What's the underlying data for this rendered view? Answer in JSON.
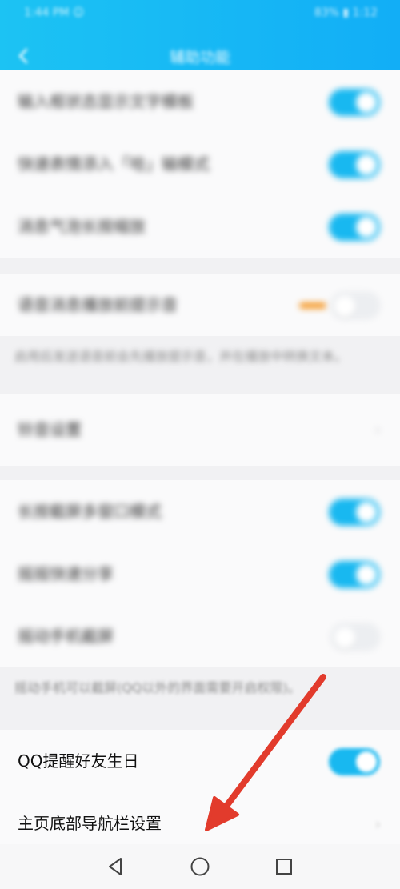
{
  "statusbar": {
    "left": "1:44 PM ☺",
    "right": "83% ▮ 1:12"
  },
  "header": {
    "title": "辅助功能"
  },
  "sections": {
    "r1": "输入框状态显示文字模板",
    "r2": "快速表情添入「哈」输模式",
    "r3": "消息气泡长按缩放",
    "r4": "语音消息播放前提示音",
    "note1": "启用后发送语音前会先播放提示音，并在播放中转换文本。",
    "r5": "铃音设置",
    "r6": "长按截屏多窗口模式",
    "r7": "摇摇快速分享",
    "r8": "摇动手机截屏",
    "note2": "摇动手机可以截屏(QQ以外的界面需要开启权限)。",
    "r9": "QQ提醒好友生日",
    "r10": "主页底部导航栏设置"
  },
  "colors": {
    "accent": "#18b8f0",
    "arrow": "#e23b2c"
  }
}
